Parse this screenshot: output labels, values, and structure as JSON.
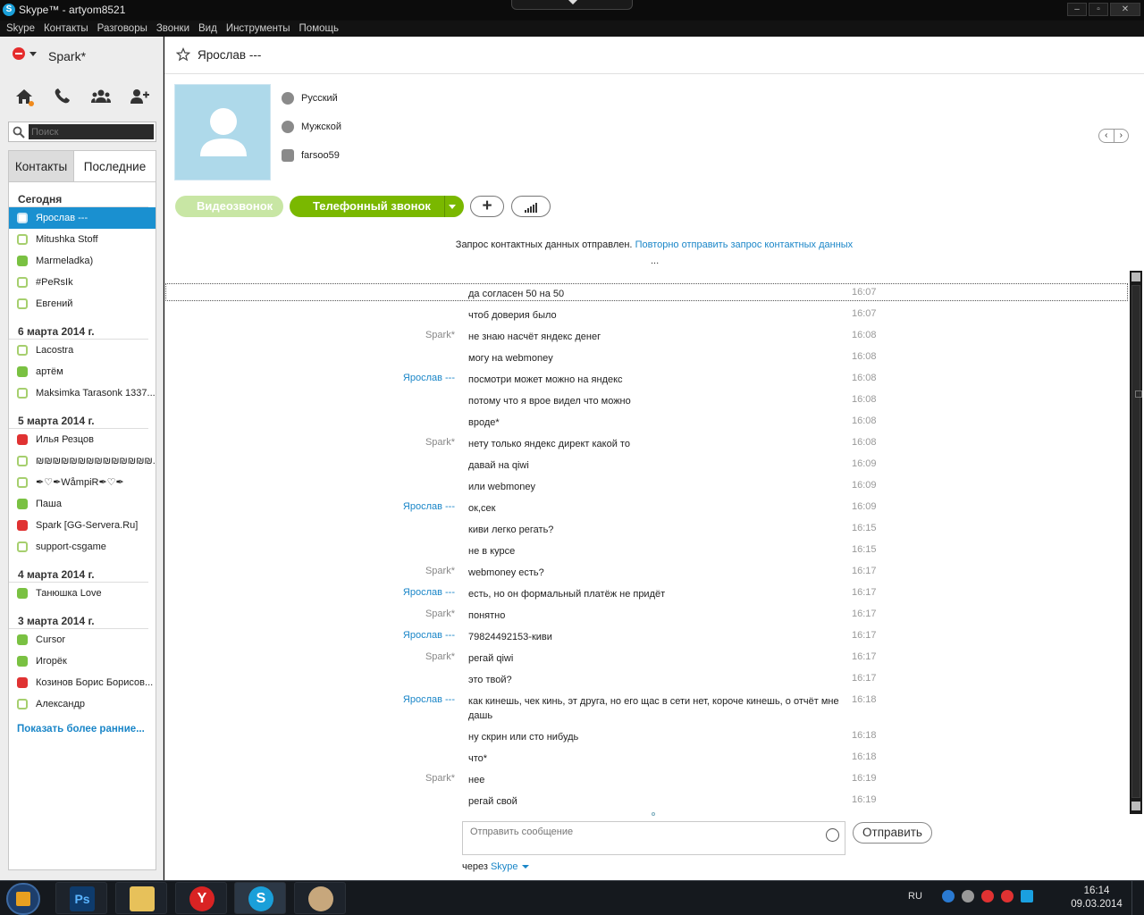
{
  "window": {
    "title": "Skype™ - artyom8521"
  },
  "menu": [
    "Skype",
    "Контакты",
    "Разговоры",
    "Звонки",
    "Вид",
    "Инструменты",
    "Помощь"
  ],
  "sidebar": {
    "user_name": "Spark*",
    "search_placeholder": "Поиск",
    "tabs": {
      "contacts": "Контакты",
      "recent": "Последние"
    },
    "groups": [
      {
        "heading": "Сегодня",
        "contacts": [
          {
            "name": "Ярослав ---",
            "status": "sel"
          },
          {
            "name": "Mitushka Stoff",
            "status": "off"
          },
          {
            "name": "Marmeladka)",
            "status": "on"
          },
          {
            "name": "#PeRsIk",
            "status": "off"
          },
          {
            "name": "Евгений",
            "status": "off"
          }
        ]
      },
      {
        "heading": "6 марта 2014 г.",
        "contacts": [
          {
            "name": "Lacostra",
            "status": "off"
          },
          {
            "name": "артём",
            "status": "on"
          },
          {
            "name": "Maksimka Tarasonk 1337...",
            "status": "off"
          }
        ]
      },
      {
        "heading": "5 марта 2014 г.",
        "contacts": [
          {
            "name": "Илья Резцов",
            "status": "red"
          },
          {
            "name": "₪₪₪₪₪₪₪₪₪₪₪₪₪₪...",
            "status": "off"
          },
          {
            "name": "✒♡✒WåmpiR✒♡✒",
            "status": "off"
          },
          {
            "name": "Паша",
            "status": "on"
          },
          {
            "name": "Spark [GG-Servera.Ru]",
            "status": "red"
          },
          {
            "name": "support-csgame",
            "status": "off"
          }
        ]
      },
      {
        "heading": "4 марта 2014 г.",
        "contacts": [
          {
            "name": "Танюшка Love",
            "status": "on"
          }
        ]
      },
      {
        "heading": "3 марта 2014 г.",
        "contacts": [
          {
            "name": "Cursor",
            "status": "on"
          },
          {
            "name": "Игорёк",
            "status": "on"
          },
          {
            "name": "Козинов Борис Борисов...",
            "status": "red"
          },
          {
            "name": "Александр",
            "status": "off"
          }
        ]
      }
    ],
    "show_more": "Показать более ранние..."
  },
  "conversation": {
    "contact_name": "Ярослав ---",
    "profile": {
      "language": "Русский",
      "gender": "Мужской",
      "skype_name": "farsoo59"
    },
    "video_button": "Видеозвонок",
    "call_button": "Телефонный звонок",
    "plus_button": "+",
    "dots": "...",
    "notice_text": "Запрос контактных данных отправлен.",
    "notice_link": "Повторно отправить запрос контактных данных",
    "messages": [
      {
        "sender": "",
        "who": "",
        "text": "да согласен 50 на 50",
        "time": "16:07",
        "highlight": true
      },
      {
        "sender": "",
        "who": "",
        "text": "чтоб доверия было",
        "time": "16:07"
      },
      {
        "sender": "Spark*",
        "who": "me",
        "text": "не знаю насчёт яндекс денег",
        "time": "16:08"
      },
      {
        "sender": "",
        "who": "",
        "text": "могу на webmoney",
        "time": "16:08"
      },
      {
        "sender": "Ярослав ---",
        "who": "them",
        "text": "посмотри может можно на яндекс",
        "time": "16:08"
      },
      {
        "sender": "",
        "who": "",
        "text": "потому что я вроe видел что можно",
        "time": "16:08"
      },
      {
        "sender": "",
        "who": "",
        "text": "вроде*",
        "time": "16:08"
      },
      {
        "sender": "Spark*",
        "who": "me",
        "text": "нету только яндекс директ какой то",
        "time": "16:08"
      },
      {
        "sender": "",
        "who": "",
        "text": "давай на qiwi",
        "time": "16:09"
      },
      {
        "sender": "",
        "who": "",
        "text": "или webmoney",
        "time": "16:09"
      },
      {
        "sender": "Ярослав ---",
        "who": "them",
        "text": "ок,сек",
        "time": "16:09"
      },
      {
        "sender": "",
        "who": "",
        "text": "киви легко регать?",
        "time": "16:15"
      },
      {
        "sender": "",
        "who": "",
        "text": "не в курсе",
        "time": "16:15"
      },
      {
        "sender": "Spark*",
        "who": "me",
        "text": "webmoney есть?",
        "time": "16:17"
      },
      {
        "sender": "Ярослав ---",
        "who": "them",
        "text": "есть, но он формальный платёж не придёт",
        "time": "16:17"
      },
      {
        "sender": "Spark*",
        "who": "me",
        "text": "понятно",
        "time": "16:17"
      },
      {
        "sender": "Ярослав ---",
        "who": "them",
        "text": "79824492153-киви",
        "time": "16:17"
      },
      {
        "sender": "Spark*",
        "who": "me",
        "text": "регай qiwi",
        "time": "16:17"
      },
      {
        "sender": "",
        "who": "",
        "text": "это твой?",
        "time": "16:17"
      },
      {
        "sender": "Ярослав ---",
        "who": "them",
        "text": "как кинешь, чек кинь, эт друга, но его щас в сети нет, короче кинешь, о отчёт мне дашь",
        "time": "16:18",
        "tall": true
      },
      {
        "sender": "",
        "who": "",
        "text": "ну скрин или сто нибудь",
        "time": "16:18"
      },
      {
        "sender": "",
        "who": "",
        "text": "что*",
        "time": "16:18"
      },
      {
        "sender": "Spark*",
        "who": "me",
        "text": "нее",
        "time": "16:19"
      },
      {
        "sender": "",
        "who": "",
        "text": "регай свой",
        "time": "16:19"
      }
    ],
    "compose_placeholder": "Отправить сообщение",
    "send_button": "Отправить",
    "via_label": "через",
    "via_link": "Skype"
  },
  "taskbar": {
    "lang": "RU",
    "time": "16:14",
    "date": "09.03.2014"
  },
  "colors": {
    "accent": "#1a90d0",
    "call_green": "#7ab800",
    "online": "#7ac142",
    "busy": "#e03232"
  }
}
